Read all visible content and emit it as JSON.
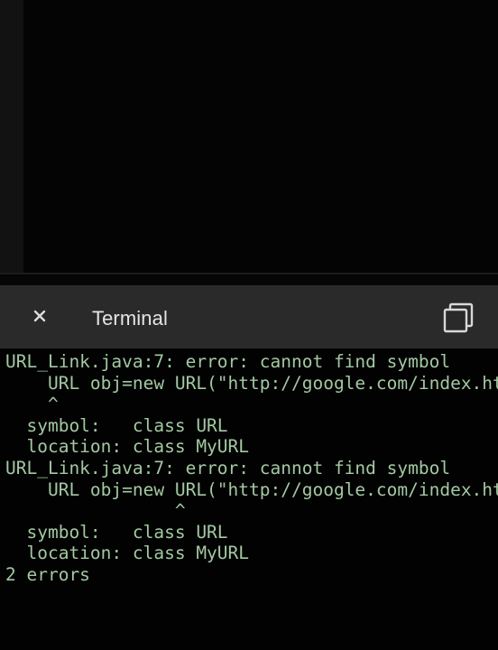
{
  "terminal": {
    "title": "Terminal",
    "close_icon": "close-icon",
    "copy_icon": "copy-icon",
    "text_color": "#a3c8a3",
    "header_color": "#2a2a2a"
  },
  "output": {
    "lines": [
      "URL_Link.java:7: error: cannot find symbol",
      "    URL obj=new URL(\"http://google.com/index.ht",
      "    ^",
      "  symbol:   class URL",
      "  location: class MyURL",
      "URL_Link.java:7: error: cannot find symbol",
      "    URL obj=new URL(\"http://google.com/index.ht",
      "                ^",
      "  symbol:   class URL",
      "  location: class MyURL",
      "2 errors"
    ]
  }
}
